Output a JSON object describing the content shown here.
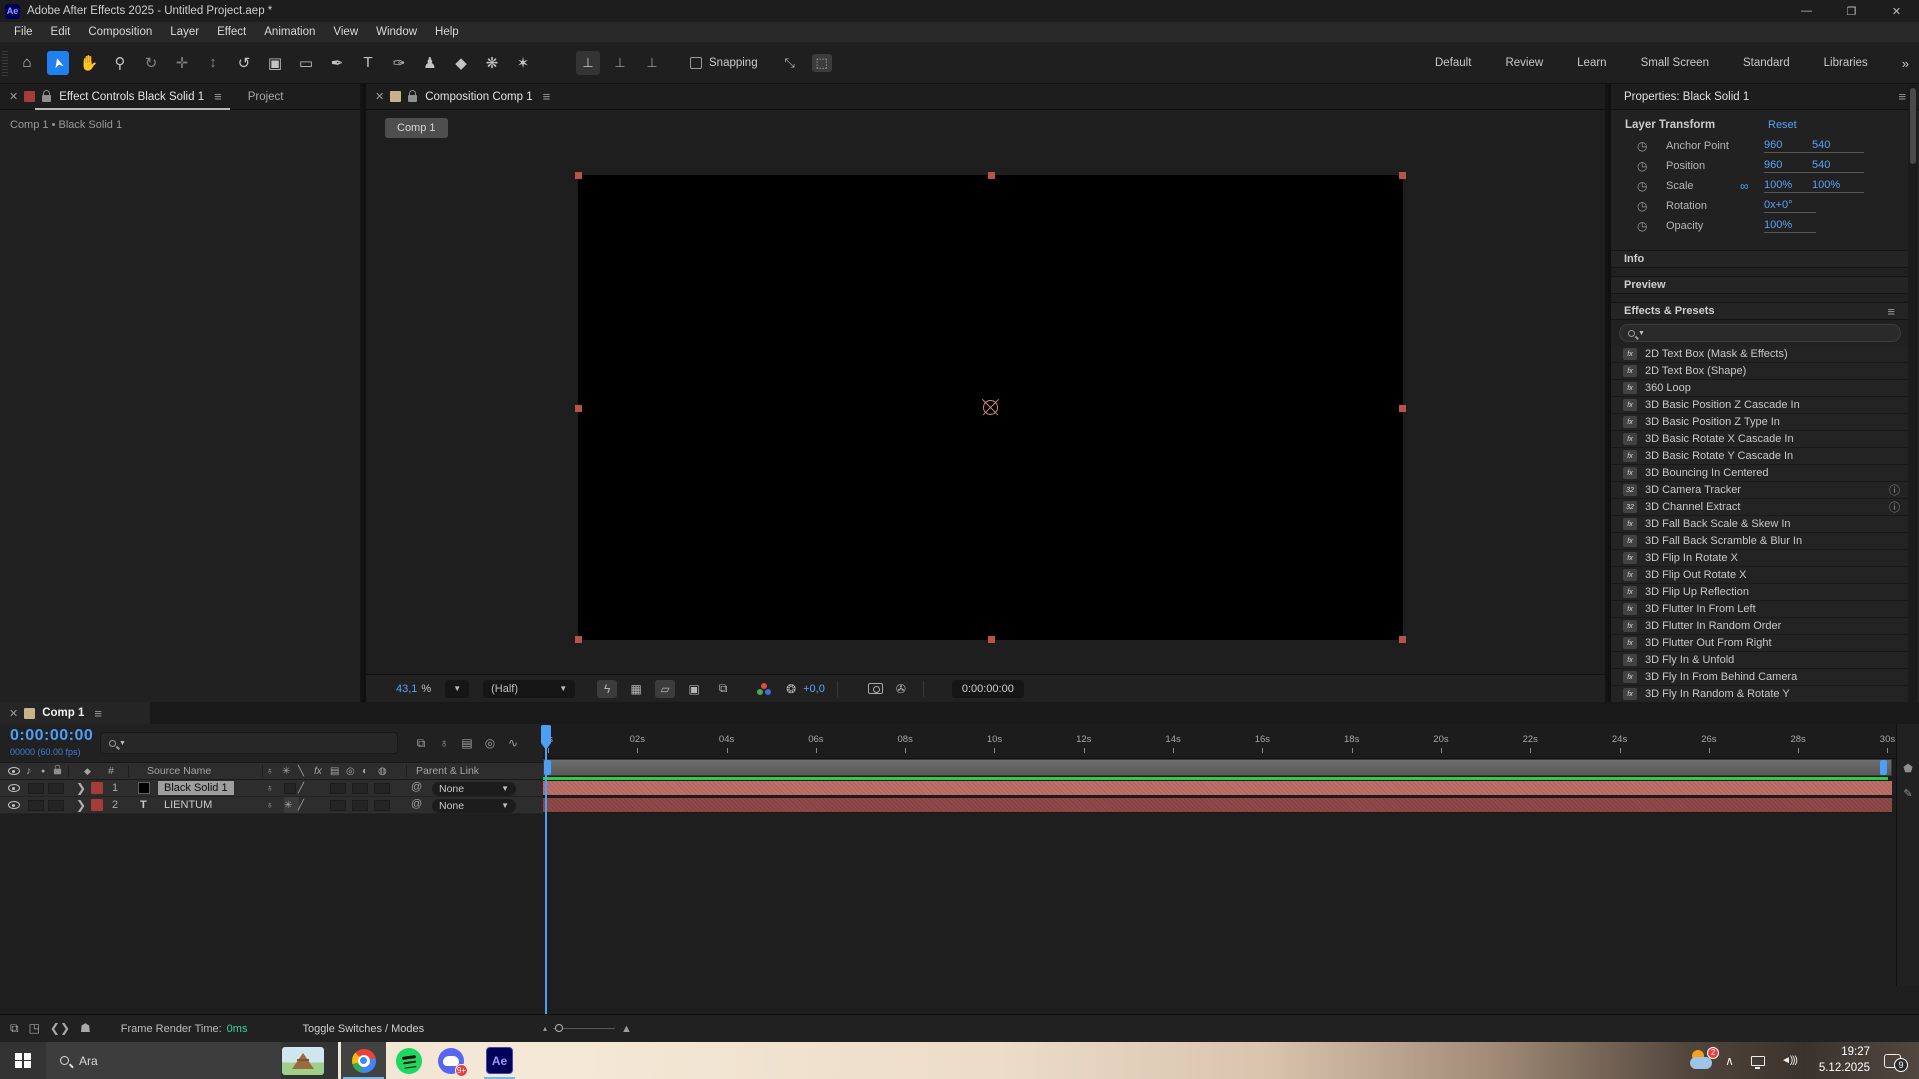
{
  "titlebar": {
    "app_badge": "Ae",
    "title": "Adobe After Effects 2025 - Untitled Project.aep *",
    "minimize": "—",
    "maximize": "❐",
    "close": "✕"
  },
  "menubar": {
    "items": [
      "File",
      "Edit",
      "Composition",
      "Layer",
      "Effect",
      "Animation",
      "View",
      "Window",
      "Help"
    ]
  },
  "toolbar": {
    "tools": [
      {
        "glyph": "⌂",
        "name": "home-tool"
      },
      {
        "glyph": "➤",
        "name": "selection-tool",
        "cls": "sel"
      },
      {
        "glyph": "✋",
        "name": "hand-tool"
      },
      {
        "glyph": "⚲",
        "name": "zoom-tool"
      },
      {
        "glyph": "↻",
        "name": "orbit-camera-tool",
        "cls": "dim"
      },
      {
        "glyph": "✛",
        "name": "pan-camera-tool",
        "cls": "dim"
      },
      {
        "glyph": "↕",
        "name": "dolly-camera-tool",
        "cls": "dim"
      },
      {
        "glyph": "↺",
        "name": "rotation-tool"
      },
      {
        "glyph": "▣",
        "name": "camera-tool"
      },
      {
        "glyph": "▭",
        "name": "rectangle-tool"
      },
      {
        "glyph": "✒",
        "name": "pen-tool"
      },
      {
        "glyph": "T",
        "name": "type-tool"
      },
      {
        "glyph": "✑",
        "name": "brush-tool"
      },
      {
        "glyph": "♟",
        "name": "clone-stamp-tool"
      },
      {
        "glyph": "◆",
        "name": "eraser-tool"
      },
      {
        "glyph": "❋",
        "name": "roto-brush-tool"
      },
      {
        "glyph": "✶",
        "name": "puppet-pin-tool"
      }
    ],
    "axis_modes": [
      {
        "glyph": "⊥",
        "name": "local-axis-mode",
        "cls": "boxed"
      },
      {
        "glyph": "⊥",
        "name": "world-axis-mode"
      },
      {
        "glyph": "⊥",
        "name": "view-axis-mode"
      }
    ],
    "snapping_label": "Snapping",
    "extra_tools": [
      {
        "glyph": "⤡",
        "name": "shared-view-icon"
      },
      {
        "glyph": "⬚",
        "name": "region-capture-icon",
        "cls": "on"
      }
    ],
    "workspaces": [
      "Default",
      "Review",
      "Learn",
      "Small Screen",
      "Standard",
      "Libraries"
    ],
    "workspace_overflow": "»"
  },
  "effect_controls": {
    "tab_label": "Effect Controls Black Solid 1",
    "project_tab_label": "Project",
    "breadcrumb": "Comp 1 • Black Solid 1"
  },
  "composition": {
    "tab_label": "Composition Comp 1",
    "comp_button": "Comp 1",
    "zoom_value": "43,1",
    "zoom_pct": "%",
    "resolution": "(Half)",
    "exposure": "+0,0",
    "timecode": "0:00:00:00"
  },
  "properties": {
    "title": "Properties: Black Solid 1",
    "section_title": "Layer Transform",
    "reset_label": "Reset",
    "rows": [
      {
        "label": "Anchor Point",
        "link": "",
        "v1": "960",
        "v2": "540"
      },
      {
        "label": "Position",
        "link": "",
        "v1": "960",
        "v2": "540"
      },
      {
        "label": "Scale",
        "link": "∞",
        "v1": "100%",
        "v2": "100%"
      },
      {
        "label": "Rotation",
        "link": "",
        "v1": "0x+0°",
        "v2": ""
      },
      {
        "label": "Opacity",
        "link": "",
        "v1": "100%",
        "v2": ""
      }
    ]
  },
  "side_panels": {
    "info": "Info",
    "preview": "Preview",
    "effects": "Effects & Presets"
  },
  "effects_list": {
    "items": [
      {
        "label": "2D Text Box (Mask & Effects)",
        "icon": "fx",
        "badge": ""
      },
      {
        "label": "2D Text Box (Shape)",
        "icon": "fx",
        "badge": ""
      },
      {
        "label": "360 Loop",
        "icon": "fx",
        "badge": ""
      },
      {
        "label": "3D Basic Position Z Cascade In",
        "icon": "fx",
        "badge": ""
      },
      {
        "label": "3D Basic Position Z Type In",
        "icon": "fx",
        "badge": ""
      },
      {
        "label": "3D Basic Rotate X Cascade In",
        "icon": "fx",
        "badge": ""
      },
      {
        "label": "3D Basic Rotate Y Cascade In",
        "icon": "fx",
        "badge": ""
      },
      {
        "label": "3D Bouncing In Centered",
        "icon": "fx",
        "badge": ""
      },
      {
        "label": "3D Camera Tracker",
        "icon": "32",
        "badge": "ⓘ"
      },
      {
        "label": "3D Channel Extract",
        "icon": "32",
        "badge": "ⓘ"
      },
      {
        "label": "3D Fall Back Scale & Skew In",
        "icon": "fx",
        "badge": ""
      },
      {
        "label": "3D Fall Back Scramble & Blur In",
        "icon": "fx",
        "badge": ""
      },
      {
        "label": "3D Flip In Rotate X",
        "icon": "fx",
        "badge": ""
      },
      {
        "label": "3D Flip Out Rotate X",
        "icon": "fx",
        "badge": ""
      },
      {
        "label": "3D Flip Up Reflection",
        "icon": "fx",
        "badge": ""
      },
      {
        "label": "3D Flutter In From Left",
        "icon": "fx",
        "badge": ""
      },
      {
        "label": "3D Flutter In Random Order",
        "icon": "fx",
        "badge": ""
      },
      {
        "label": "3D Flutter Out From Right",
        "icon": "fx",
        "badge": ""
      },
      {
        "label": "3D Fly In & Unfold",
        "icon": "fx",
        "badge": ""
      },
      {
        "label": "3D Fly In From Behind Camera",
        "icon": "fx",
        "badge": ""
      },
      {
        "label": "3D Fly In Random & Rotate Y",
        "icon": "fx",
        "badge": ""
      }
    ]
  },
  "timeline": {
    "tab_label": "Comp 1",
    "timecode": "0:00:00:00",
    "frame_info": "00000 (60.00 fps)",
    "columns": {
      "hash": "#",
      "source_name": "Source Name",
      "parent_link": "Parent & Link"
    },
    "layers": [
      {
        "index": "1",
        "name": "Black Solid 1",
        "parent": "None"
      },
      {
        "index": "2",
        "type_badge": "T",
        "name": "LIENTUM",
        "parent": "None"
      }
    ],
    "ruler": [
      {
        "label": "0s"
      },
      {
        "label": "02s"
      },
      {
        "label": "04s"
      },
      {
        "label": "06s"
      },
      {
        "label": "08s"
      },
      {
        "label": "10s"
      },
      {
        "label": "12s"
      },
      {
        "label": "14s"
      },
      {
        "label": "16s"
      },
      {
        "label": "18s"
      },
      {
        "label": "20s"
      },
      {
        "label": "22s"
      },
      {
        "label": "24s"
      },
      {
        "label": "26s"
      },
      {
        "label": "28s"
      },
      {
        "label": "30s"
      }
    ]
  },
  "statusbar": {
    "render_label": "Frame Render Time:",
    "render_value": "0ms",
    "toggle_label": "Toggle Switches / Modes"
  },
  "taskbar": {
    "search_placeholder": "Ara",
    "discord_badge": "9+",
    "weather_badge": "2",
    "time": "19:27",
    "date": "5.12.2025",
    "notification_badge": "9"
  },
  "colors": {
    "accent_blue": "#4d9ef6",
    "value_blue": "#5aa2f7",
    "label_red": "#a43d3a",
    "layer_bar_top": "#bd6f68",
    "layer_bar_bottom": "#8f4a48",
    "render_line_green": "#2ecc40",
    "render_time_teal": "#35d69f",
    "selection_tool_blue": "#2180f0"
  }
}
